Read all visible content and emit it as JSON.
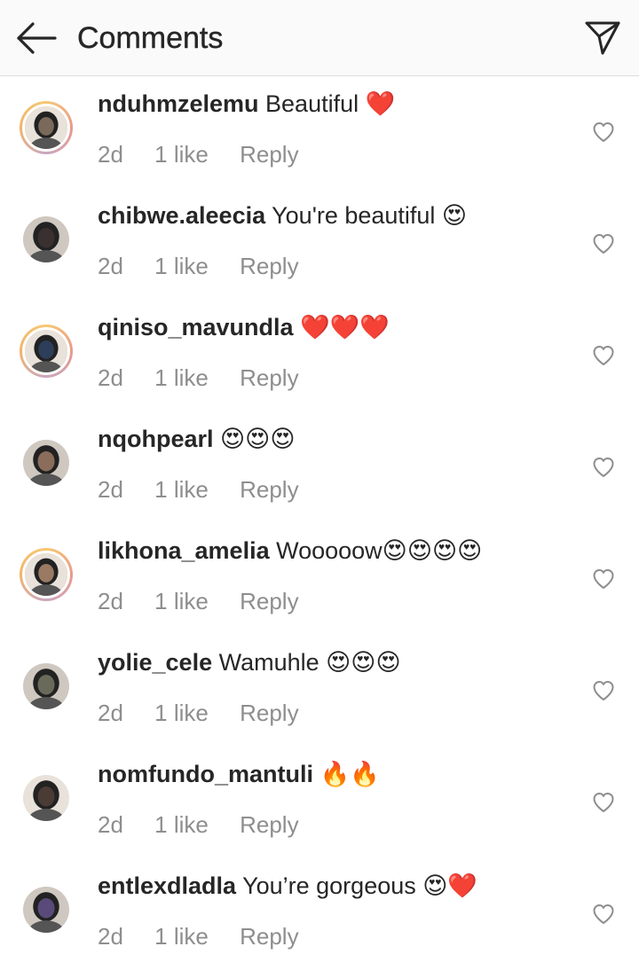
{
  "header": {
    "title": "Comments"
  },
  "comments": [
    {
      "username": "nduhmzelemu",
      "text": "Beautiful ❤️",
      "time": "2d",
      "likes": "1 like",
      "reply": "Reply",
      "avatar_ring": true,
      "avatar_color": "#7a6a5a"
    },
    {
      "username": "chibwe.aleecia",
      "text": "You're beautiful 😍",
      "time": "2d",
      "likes": "1 like",
      "reply": "Reply",
      "avatar_ring": false,
      "avatar_color": "#3b3030"
    },
    {
      "username": "qiniso_mavundla",
      "text": "❤️❤️❤️",
      "time": "2d",
      "likes": "1 like",
      "reply": "Reply",
      "avatar_ring": true,
      "avatar_color": "#2d3e5a"
    },
    {
      "username": "nqohpearl",
      "text": "😍😍😍",
      "time": "2d",
      "likes": "1 like",
      "reply": "Reply",
      "avatar_ring": false,
      "avatar_color": "#8a6d5a"
    },
    {
      "username": "likhona_amelia",
      "text": "Wooooow😍😍😍😍",
      "time": "2d",
      "likes": "1 like",
      "reply": "Reply",
      "avatar_ring": true,
      "avatar_color": "#9a7a62"
    },
    {
      "username": "yolie_cele",
      "text": "Wamuhle 😍😍😍",
      "time": "2d",
      "likes": "1 like",
      "reply": "Reply",
      "avatar_ring": false,
      "avatar_color": "#6a6a5a"
    },
    {
      "username": "nomfundo_mantuli",
      "text": "🔥🔥",
      "time": "2d",
      "likes": "1 like",
      "reply": "Reply",
      "avatar_ring": false,
      "avatar_color": "#4a3b35"
    },
    {
      "username": "entlexdladla",
      "text": "You’re gorgeous 😍❤️",
      "time": "2d",
      "likes": "1 like",
      "reply": "Reply",
      "avatar_ring": false,
      "avatar_color": "#5a4a7a"
    }
  ]
}
